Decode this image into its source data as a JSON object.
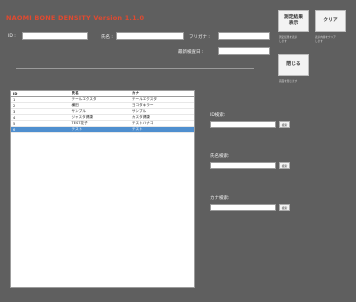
{
  "app": {
    "title": "NAOMI BONE DENSITY  Version 1.1.0"
  },
  "header": {
    "id_label": "ID :",
    "name_label": "氏名 :",
    "kana_label": "フリガナ :",
    "lastdate_label": "最新検査日 :",
    "id_value": "",
    "name_value": "",
    "kana_value": "",
    "lastdate_value": ""
  },
  "buttons": {
    "show_results": "測定結果\n表示",
    "clear": "クリア",
    "close": "閉じる",
    "show_results_note": "測定結果を表示\nします",
    "clear_note": "表示内容をクリア\nします",
    "close_note": "画面を閉じます"
  },
  "grid": {
    "columns": [
      "ID",
      "氏名",
      "カナ"
    ],
    "rows": [
      [
        "1",
        "テールエクスタ",
        "テールエクスタ"
      ],
      [
        "2",
        "横田",
        "ヨコタキラー"
      ],
      [
        "3",
        "サンプル",
        "サンプル"
      ],
      [
        "4",
        "ジャスタ健康",
        "カスタ健康"
      ],
      [
        "5",
        "TEST花子",
        "テストハナコ"
      ],
      [
        "6",
        "テスト",
        "テスト"
      ]
    ],
    "selected_row": 5
  },
  "search": {
    "id_label": "ID検索:",
    "name_label": "氏名検索:",
    "kana_label": "カナ検索:",
    "button_label": "検索"
  }
}
